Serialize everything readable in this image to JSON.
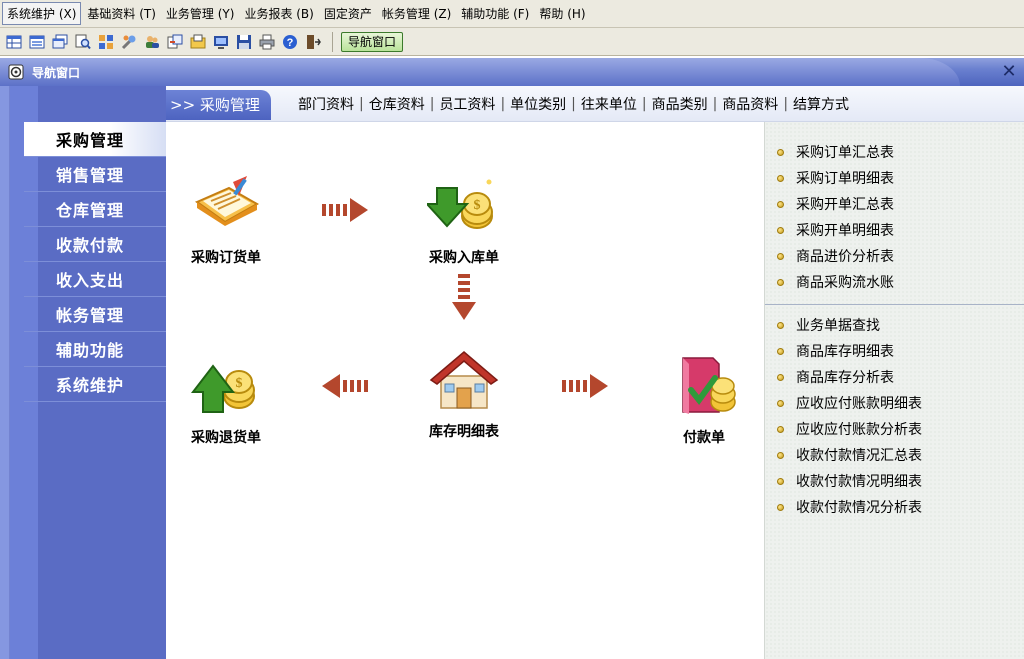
{
  "menubar": {
    "items": [
      {
        "label": "系统维护 (X)",
        "active": true
      },
      {
        "label": "基础资料 (T)"
      },
      {
        "label": "业务管理 (Y)"
      },
      {
        "label": "业务报表 (B)"
      },
      {
        "label": "固定资产"
      },
      {
        "label": "帐务管理 (Z)"
      },
      {
        "label": "辅助功能 (F)"
      },
      {
        "label": "帮助 (H)"
      }
    ]
  },
  "toolbar": {
    "nav_window_label": "导航窗口"
  },
  "window": {
    "title": "导航窗口",
    "close_glyph": "✕"
  },
  "sidebar": {
    "items": [
      {
        "label": "采购管理",
        "active": true
      },
      {
        "label": "销售管理"
      },
      {
        "label": "仓库管理"
      },
      {
        "label": "收款付款"
      },
      {
        "label": "收入支出"
      },
      {
        "label": "帐务管理"
      },
      {
        "label": "辅助功能"
      },
      {
        "label": "系统维护"
      }
    ]
  },
  "topbar": {
    "current": ">> 采购管理",
    "links": [
      "部门资料",
      "仓库资料",
      "员工资料",
      "单位类别",
      "往来单位",
      "商品类别",
      "商品资料",
      "结算方式"
    ]
  },
  "flow": {
    "nodes": {
      "purchase_order": {
        "label": "采购订货单",
        "icon": "order-form-icon"
      },
      "purchase_in": {
        "label": "采购入库单",
        "icon": "stock-in-coins-icon"
      },
      "purchase_return": {
        "label": "采购退货单",
        "icon": "return-coins-icon"
      },
      "inventory_detail": {
        "label": "库存明细表",
        "icon": "warehouse-house-icon"
      },
      "payment": {
        "label": "付款单",
        "icon": "payment-icon"
      }
    },
    "arrow_color": "#b4472d"
  },
  "reports": {
    "group1": [
      "采购订单汇总表",
      "采购订单明细表",
      "采购开单汇总表",
      "采购开单明细表",
      "商品进价分析表",
      "商品采购流水账"
    ],
    "group2": [
      "业务单据查找",
      "商品库存明细表",
      "商品库存分析表",
      "应收应付账款明细表",
      "应收应付账款分析表",
      "收款付款情况汇总表",
      "收款付款情况明细表",
      "收款付款情况分析表"
    ]
  },
  "colors": {
    "sidebar": "#5a6cc4",
    "title_bar": "#6a80cf",
    "bullet": "#d4a82a"
  }
}
